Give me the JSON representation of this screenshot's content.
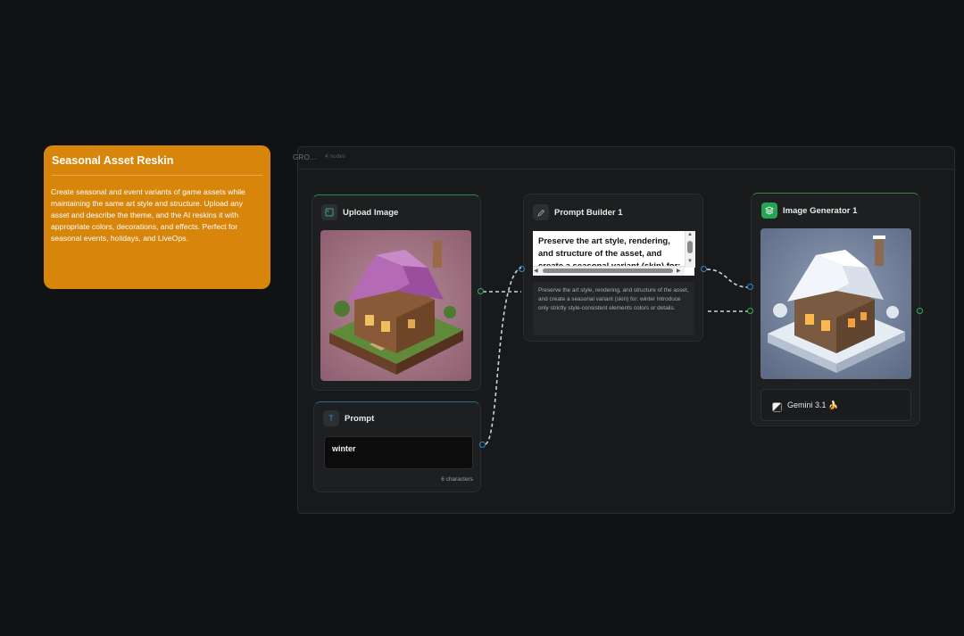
{
  "info_card": {
    "title": "Seasonal Asset Reskin",
    "description": "Create seasonal and event variants of game assets while maintaining the same art style and structure. Upload any asset and describe the theme, and the AI reskins it with appropriate colors, decorations, and effects. Perfect for seasonal events, holidays, and LiveOps."
  },
  "group": {
    "label": "GRO...",
    "count": "4 nodes"
  },
  "nodes": {
    "upload": {
      "title": "Upload Image",
      "icon": "image-icon"
    },
    "prompt": {
      "title": "Prompt",
      "icon": "text-icon",
      "value": "winter",
      "char_count": "6 characters"
    },
    "builder": {
      "title": "Prompt Builder 1",
      "icon": "pencil-icon",
      "preview": "Preserve the art style, rendering, and structure of the asset, and create a seasonal variant (skin) for:",
      "description": "Preserve the art style, rendering, and structure of the asset, and create a seasonal variant (skin) for: winter Introduce only strictly style-consistent elements colors or details."
    },
    "generator": {
      "title": "Image Generator 1",
      "icon": "layers-icon",
      "model": "Gemini 3.1 🍌"
    }
  },
  "colors": {
    "card_orange": "#d8860b",
    "port_green": "#2bb35a",
    "port_blue": "#2a8ad0",
    "node_bg": "#1d1f21"
  }
}
